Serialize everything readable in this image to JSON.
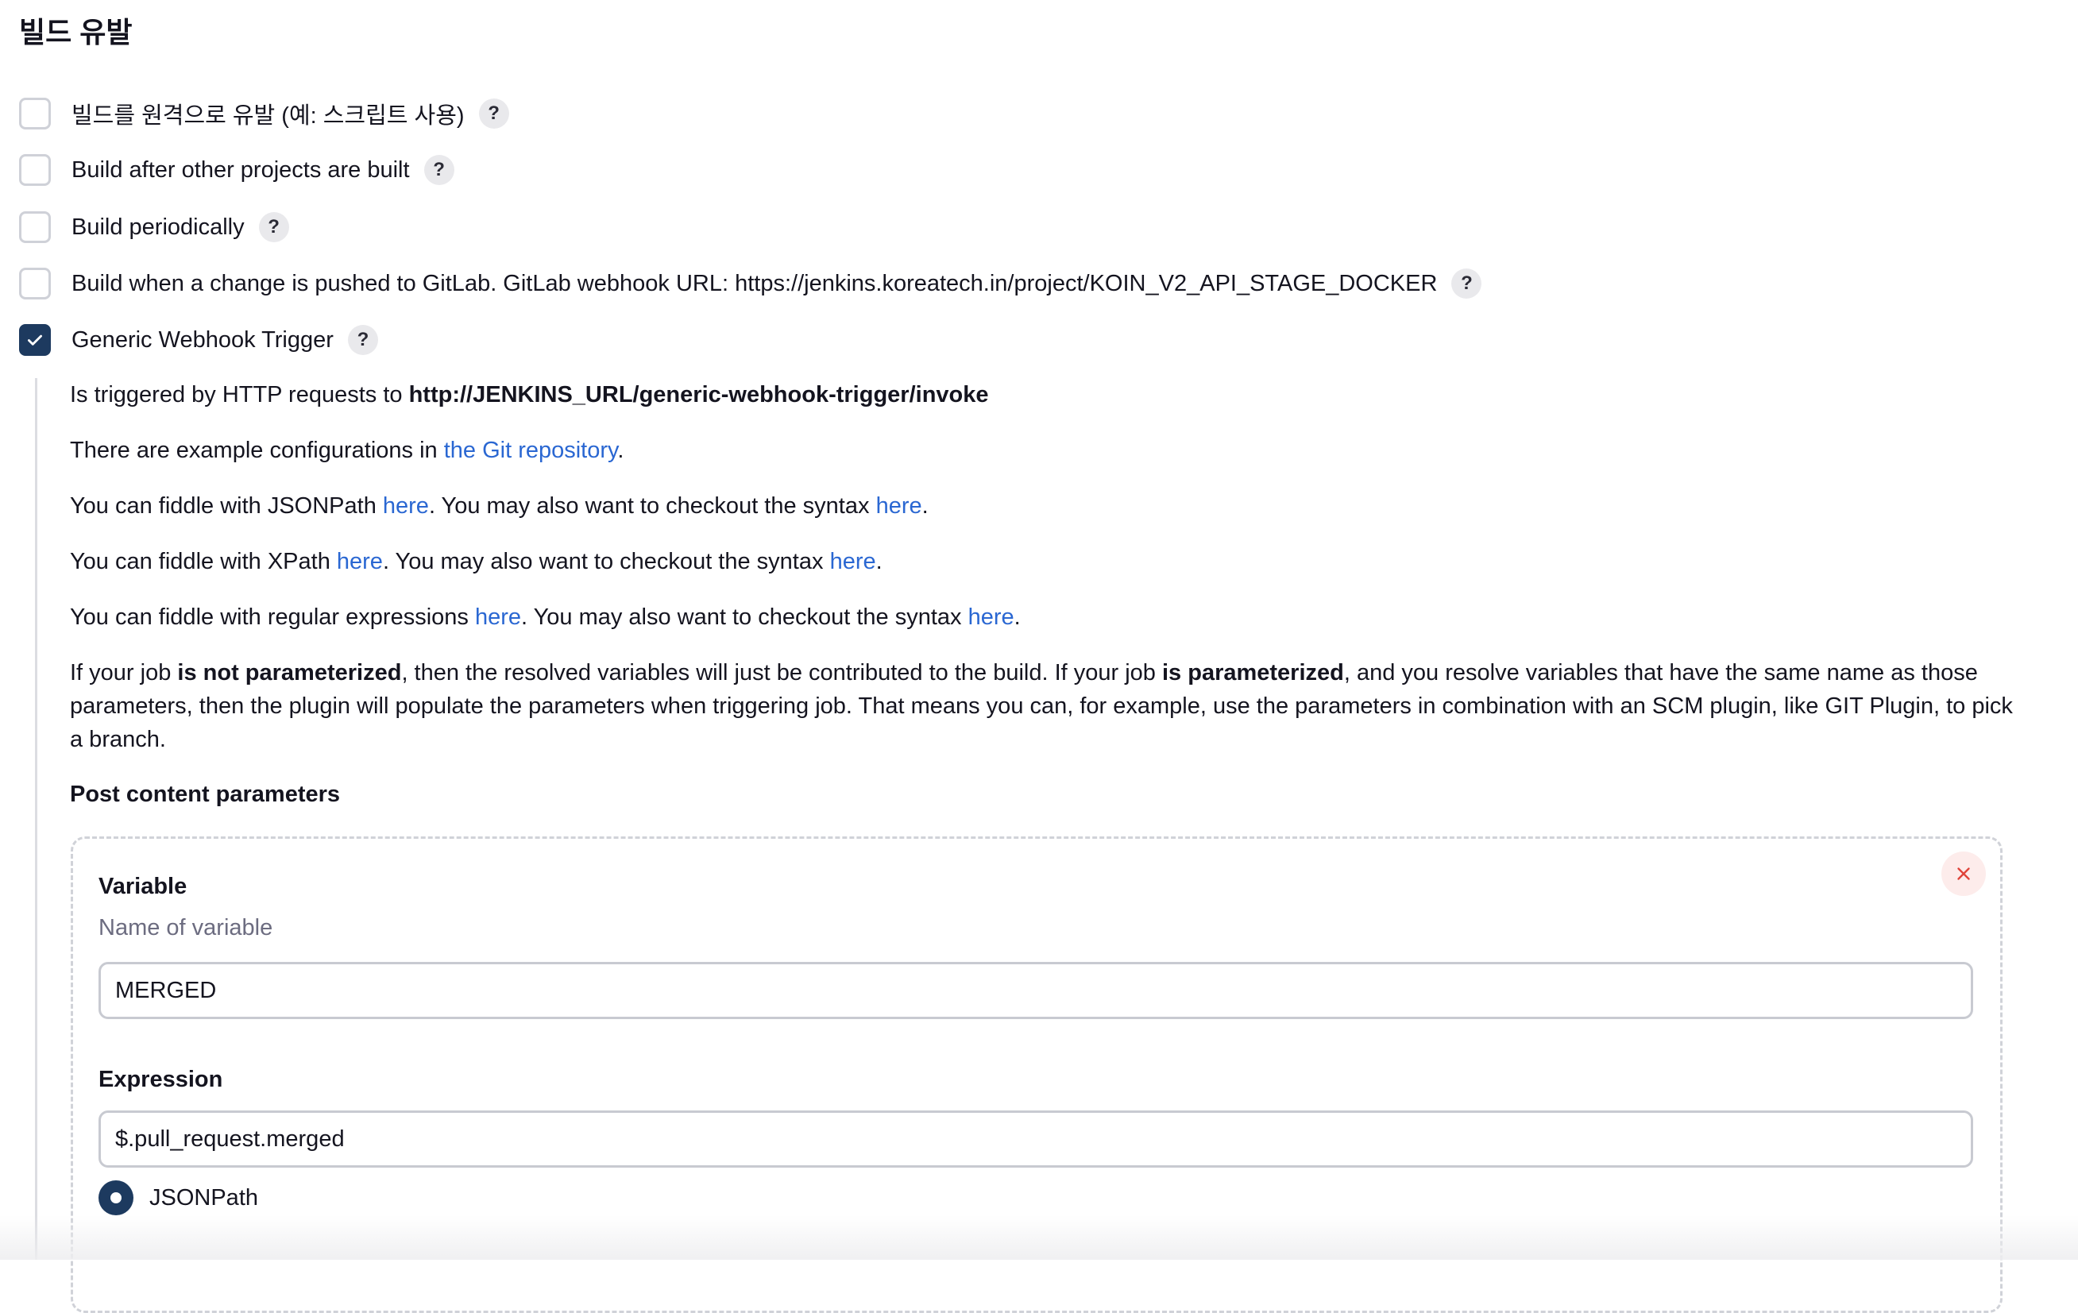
{
  "section": {
    "title": "빌드 유발"
  },
  "triggers": [
    {
      "label": "빌드를 원격으로 유발 (예: 스크립트 사용)",
      "checked": false,
      "help": "?"
    },
    {
      "label": "Build after other projects are built",
      "checked": false,
      "help": "?"
    },
    {
      "label": "Build periodically",
      "checked": false,
      "help": "?"
    },
    {
      "label": "Build when a change is pushed to GitLab. GitLab webhook URL: https://jenkins.koreatech.in/project/KOIN_V2_API_STAGE_DOCKER",
      "checked": false,
      "help": "?"
    },
    {
      "label": "Generic Webhook Trigger",
      "checked": true,
      "help": "?"
    }
  ],
  "generic": {
    "triggered_prefix": "Is triggered by HTTP requests to ",
    "triggered_url": "http://JENKINS_URL/generic-webhook-trigger/invoke",
    "examples_prefix": "There are example configurations in ",
    "examples_link": "the Git repository",
    "period": ".",
    "jsonpath_prefix": "You can fiddle with JSONPath ",
    "xpath_prefix": "You can fiddle with XPath ",
    "regex_prefix": "You can fiddle with regular expressions ",
    "here": "here",
    "syntax_middle": ". You may also want to checkout the syntax ",
    "param_1": "If your job ",
    "param_bold_1": "is not parameterized",
    "param_2": ", then the resolved variables will just be contributed to the build. If your job ",
    "param_bold_2": "is parameterized",
    "param_3": ", and you resolve variables that have the same name as those parameters, then the plugin will populate the parameters when triggering job. That means you can, for example, use the parameters in combination with an SCM plugin, like GIT Plugin, to pick a branch.",
    "post_heading": "Post content parameters"
  },
  "variable": {
    "label": "Variable",
    "sublabel": "Name of variable",
    "value": "MERGED"
  },
  "expression": {
    "label": "Expression",
    "value": "$.pull_request.merged",
    "option_selected": "JSONPath"
  },
  "colors": {
    "accent": "#1d3a5f",
    "link": "#2a67d2",
    "delete": "#e0443a"
  }
}
